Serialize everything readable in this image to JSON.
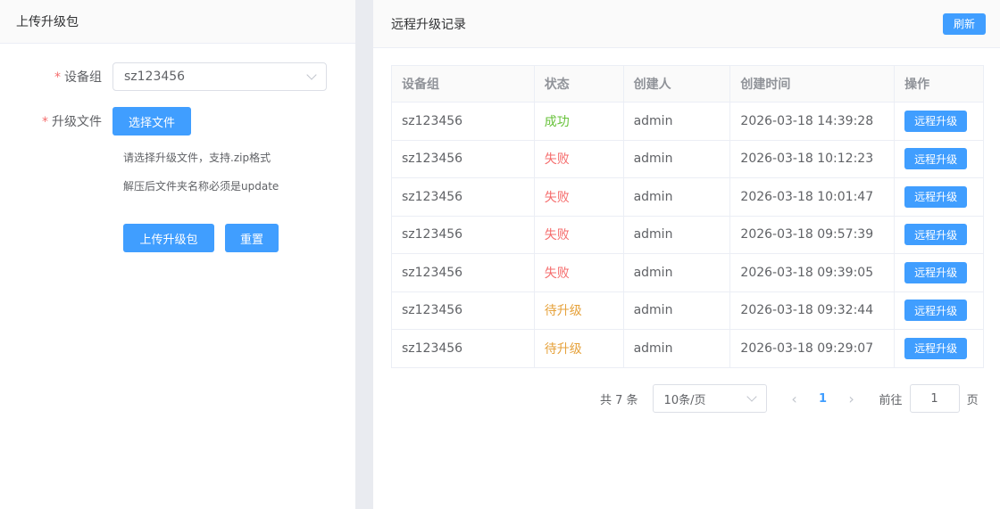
{
  "left": {
    "title": "上传升级包",
    "group_label": "设备组",
    "group_value": "sz123456",
    "file_label": "升级文件",
    "choose_file": "选择文件",
    "tip1": "请选择升级文件，支持.zip格式",
    "tip2": "解压后文件夹名称必须是update",
    "upload_btn": "上传升级包",
    "reset_btn": "重置",
    "required_mark": "*"
  },
  "right": {
    "title": "远程升级记录",
    "refresh": "刷新",
    "columns": [
      "设备组",
      "状态",
      "创建人",
      "创建时间",
      "操作"
    ],
    "rows": [
      {
        "group": "sz123456",
        "status": "成功",
        "status_type": "success",
        "creator": "admin",
        "time": "2026-03-18 14:39:28",
        "action": "远程升级"
      },
      {
        "group": "sz123456",
        "status": "失败",
        "status_type": "fail",
        "creator": "admin",
        "time": "2026-03-18 10:12:23",
        "action": "远程升级"
      },
      {
        "group": "sz123456",
        "status": "失败",
        "status_type": "fail",
        "creator": "admin",
        "time": "2026-03-18 10:01:47",
        "action": "远程升级"
      },
      {
        "group": "sz123456",
        "status": "失败",
        "status_type": "fail",
        "creator": "admin",
        "time": "2026-03-18 09:57:39",
        "action": "远程升级"
      },
      {
        "group": "sz123456",
        "status": "失败",
        "status_type": "fail",
        "creator": "admin",
        "time": "2026-03-18 09:39:05",
        "action": "远程升级"
      },
      {
        "group": "sz123456",
        "status": "待升级",
        "status_type": "wait",
        "creator": "admin",
        "time": "2026-03-18 09:32:44",
        "action": "远程升级"
      },
      {
        "group": "sz123456",
        "status": "待升级",
        "status_type": "wait",
        "creator": "admin",
        "time": "2026-03-18 09:29:07",
        "action": "远程升级"
      }
    ],
    "pager": {
      "total": "共 7 条",
      "page_size": "10条/页",
      "current_page": "1",
      "goto_label": "前往",
      "goto_value": "1",
      "page_unit": "页"
    }
  },
  "colors": {
    "primary": "#409eff",
    "success": "#67c23a",
    "danger": "#f56c6c",
    "warning": "#e6a23c"
  },
  "icons": [
    "chevron-down-icon",
    "chevron-left-icon",
    "chevron-right-icon"
  ]
}
